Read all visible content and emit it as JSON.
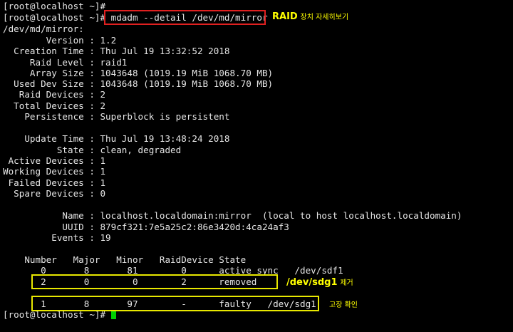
{
  "terminal": {
    "lines": [
      "[root@localhost ~]#",
      "[root@localhost ~]# mdadm --detail /dev/md/mirror",
      "/dev/md/mirror:",
      "        Version : 1.2",
      "  Creation Time : Thu Jul 19 13:32:52 2018",
      "     Raid Level : raid1",
      "     Array Size : 1043648 (1019.19 MiB 1068.70 MB)",
      "  Used Dev Size : 1043648 (1019.19 MiB 1068.70 MB)",
      "   Raid Devices : 2",
      "  Total Devices : 2",
      "    Persistence : Superblock is persistent",
      "",
      "    Update Time : Thu Jul 19 13:48:24 2018",
      "          State : clean, degraded",
      " Active Devices : 1",
      "Working Devices : 1",
      " Failed Devices : 1",
      "  Spare Devices : 0",
      "",
      "           Name : localhost.localdomain:mirror  (local to host localhost.localdomain)",
      "           UUID : 879cf321:7e5a25c2:86e3420d:4ca24af3",
      "         Events : 19",
      "",
      "    Number   Major   Minor   RaidDevice State",
      "       0       8       81        0      active sync   /dev/sdf1",
      "       2       0        0        2      removed",
      "",
      "       1       8       97        -      faulty   /dev/sdg1",
      "[root@localhost ~]# "
    ]
  },
  "annotations": {
    "raid_detail": {
      "bold": "RAID",
      "text": "장치 자세히보기"
    },
    "removed": {
      "bold": "/dev/sdg1",
      "text": "제거"
    },
    "faulty": {
      "text": "고장 확인"
    }
  },
  "colors": {
    "background": "#000000",
    "text": "#e6e6e6",
    "cursor": "#00d000",
    "highlight_red": "#e02020",
    "highlight_yellow": "#e8e800",
    "annotation": "#ffff00"
  },
  "icons": {
    "cursor": "block-cursor"
  }
}
